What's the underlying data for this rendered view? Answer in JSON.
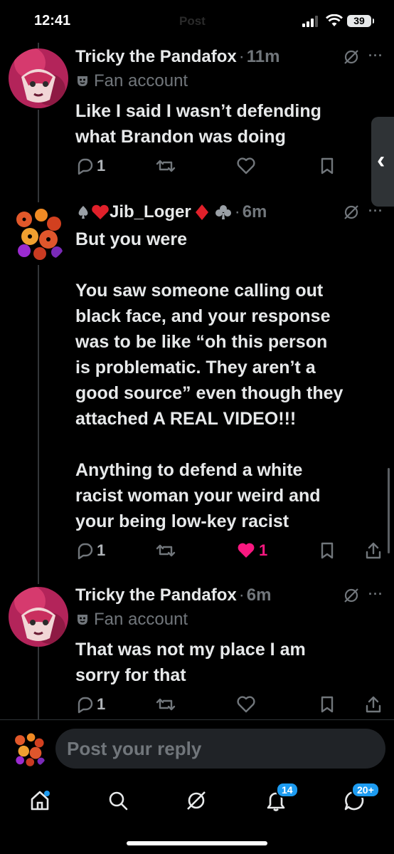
{
  "status_bar": {
    "time": "12:41",
    "header_ghost": "Post",
    "battery": "39"
  },
  "posts": [
    {
      "author": "Tricky the Pandafox",
      "separator": "·",
      "time": "11m",
      "badge": "Fan account",
      "text": "Like I said I wasn’t defending\nwhat Brandon was doing",
      "reply_count": "1",
      "like_count": "",
      "liked": false
    },
    {
      "author": "Jib_Loger",
      "author_prefix_icons": [
        "spade-icon",
        "heart-suit-icon"
      ],
      "author_suffix_icons": [
        "diamond-suit-icon",
        "club-icon"
      ],
      "separator": "·",
      "time": "6m",
      "text": "But you were\n\nYou saw someone calling out\nblack face, and your response\nwas to be like  “oh this person\nis problematic. They aren’t a\ngood source” even though they\nattached A REAL VIDEO!!!\n\nAnything to defend a white\nracist woman your weird and\nyour being low-key racist",
      "reply_count": "1",
      "like_count": "1",
      "liked": true
    },
    {
      "author": "Tricky the Pandafox",
      "separator": "·",
      "time": "6m",
      "badge": "Fan account",
      "text": "That was not my place I am\nsorry for that",
      "reply_count": "1",
      "like_count": "",
      "liked": false
    }
  ],
  "reply": {
    "placeholder": "Post your reply"
  },
  "tabbar": {
    "items": [
      "home-icon",
      "search-icon",
      "grok-icon",
      "notifications-icon",
      "messages-icon"
    ],
    "notifications_count": "14",
    "messages_count": "20+"
  },
  "colors": {
    "accent": "#1d9bf0",
    "like": "#f91880",
    "muted": "#71767b",
    "background": "#000000"
  }
}
